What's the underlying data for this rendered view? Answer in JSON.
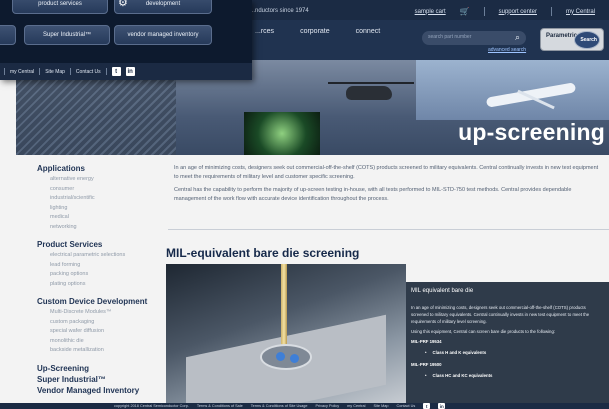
{
  "header": {
    "tagline": "...nductors since 1974",
    "links": {
      "sample_cart": "sample cart",
      "support_center": "support center",
      "my_central": "my Central"
    },
    "nav": [
      "...rces",
      "corporate",
      "connect"
    ],
    "search_placeholder": "search part number",
    "advanced_search": "advanced search",
    "parametric": {
      "word": "Parametric",
      "badge": "Search"
    }
  },
  "overlay": {
    "tiles": {
      "product_services": "product services",
      "development": "development",
      "super_industrial": "Super Industrial™",
      "vmi": "vendor managed inventory"
    },
    "footer": [
      "my Central",
      "Site Map",
      "Contact Us"
    ]
  },
  "hero": {
    "title": "up-screening"
  },
  "sidebar": {
    "applications": {
      "label": "Applications",
      "items": [
        "alternative energy",
        "consumer",
        "industrial/scientific",
        "lighting",
        "medical",
        "networking"
      ]
    },
    "product_services": {
      "label": "Product Services",
      "items": [
        "electrical parametric selections",
        "lead forming",
        "packing options",
        "plating options"
      ]
    },
    "custom_device": {
      "label": "Custom Device Development",
      "items": [
        "Multi-Discrete Modules™",
        "custom packaging",
        "special wafer diffusion",
        "monolithic die",
        "backside metallization"
      ]
    },
    "links": [
      "Up-Screening",
      "Super Industrial™",
      "Vendor Managed Inventory"
    ]
  },
  "content": {
    "para1": "In an age of minimizing costs, designers seek out commercial-off-the-shelf (COTS) products screened to military equivalents. Central continually invests in new test equipment to meet the requirements of military level and customer specific screening.",
    "para2": "Central has the capability to perform the majority of up-screen testing in-house, with all tests performed to MIL-STD-750 test methods. Central provides dependable management of the work flow with accurate device identification throughout the process.",
    "section_title": "MIL-equivalent bare die screening",
    "card": {
      "title": "MIL equivalent bare die",
      "p1": "In an age of minimizing costs, designers seek out commercial-off-the-shelf (COTS) products screened to military equivalents. Central continually invests in new test equipment to meet the requirements of military level screening.",
      "p2": "Using this equipment, Central can screen bare die products to the following:",
      "spec1": "MIL-PRF 19534",
      "spec1_item": "Class H and K equivalents",
      "spec2": "MIL-PRF 19500",
      "spec2_item": "Class HC and KC equivalents"
    }
  },
  "footer": {
    "items": [
      "copyright 2018 Central Semiconductor Corp.",
      "Terms & Conditions of Sale",
      "Terms & Conditions of Site Usage",
      "Privacy Policy",
      "my Central",
      "Site Map",
      "Contact Us"
    ]
  }
}
